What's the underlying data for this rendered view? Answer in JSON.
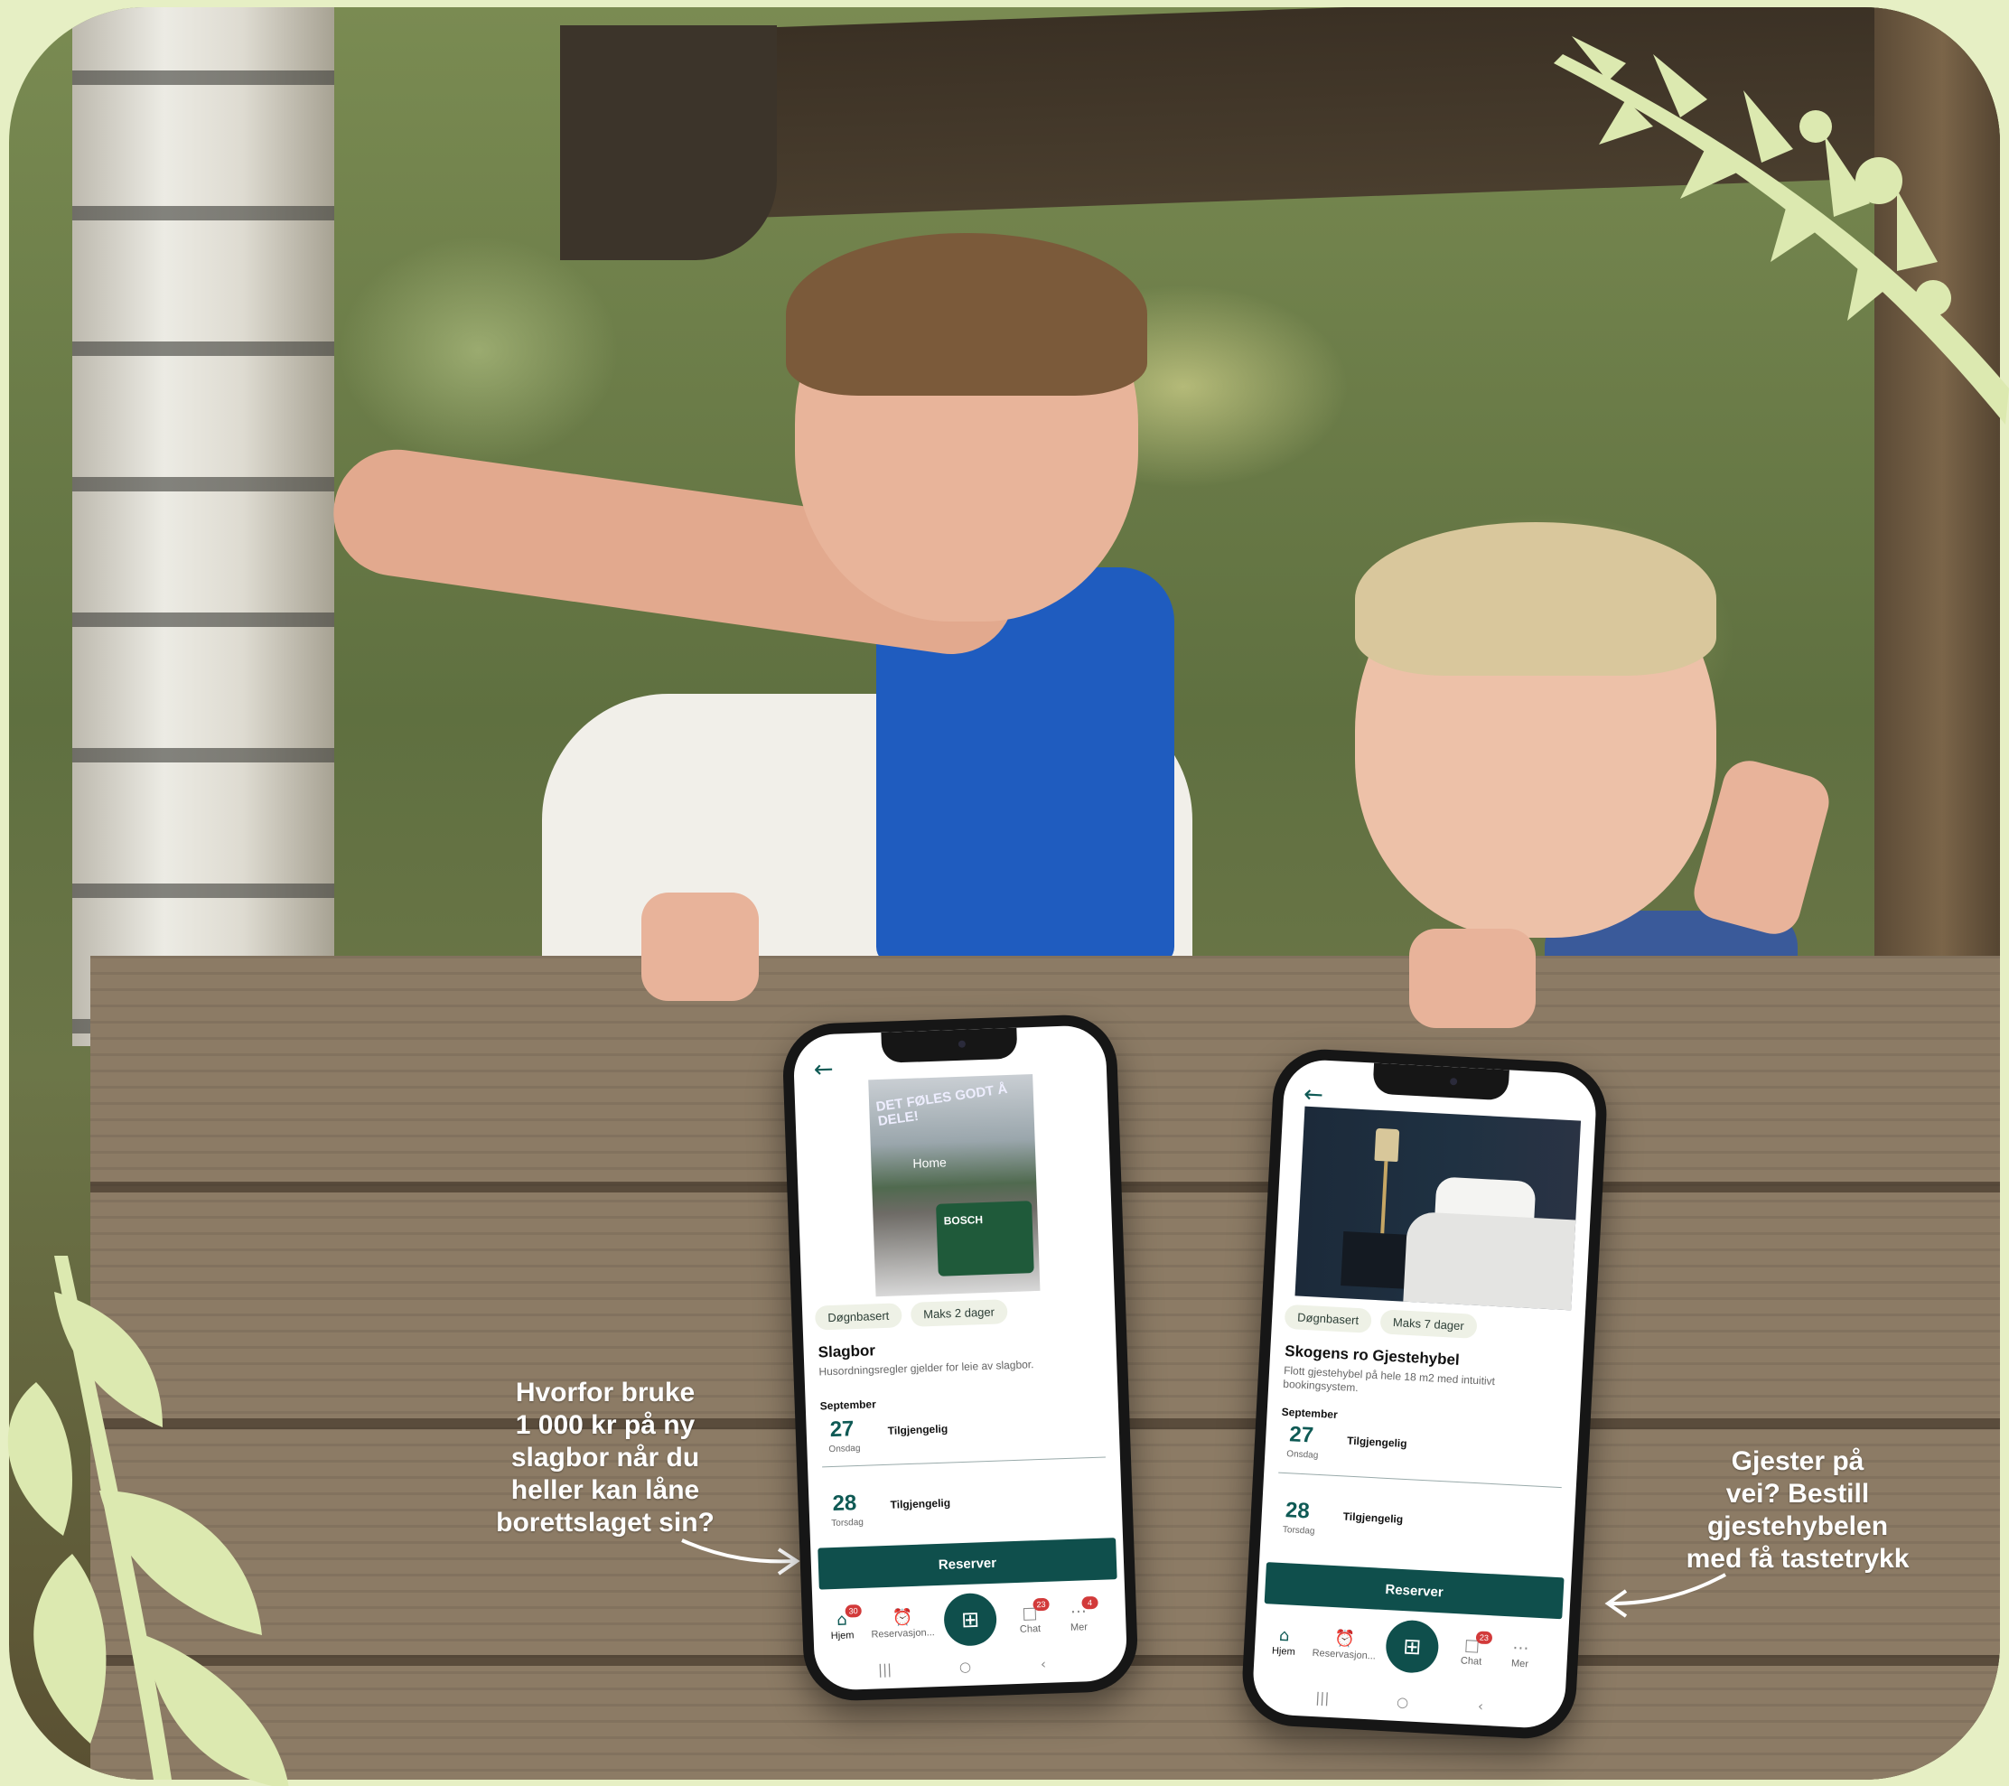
{
  "callouts": {
    "left": [
      "Hvorfor bruke",
      "1 000 kr på ny",
      "slagbor når du",
      "heller kan låne",
      "borettslaget sin?"
    ],
    "right": [
      "Gjester på",
      "vei? Bestill",
      "gjestehybelen",
      "med få tastetrykk"
    ]
  },
  "phone1": {
    "hero_slogan": "DET FØLES GODT Å DELE!",
    "hero_home": "Home",
    "hero_brand": "BOSCH",
    "tags": [
      "Døgnbasert",
      "Maks 2 dager"
    ],
    "title": "Slagbor",
    "description": "Husordningsregler gjelder for leie av slagbor.",
    "month": "September",
    "days": [
      {
        "num": "27",
        "name": "Onsdag",
        "status": "Tilgjengelig"
      },
      {
        "num": "28",
        "name": "Torsdag",
        "status": "Tilgjengelig"
      }
    ],
    "reserve_label": "Reserver",
    "tabs": [
      {
        "label": "Hjem",
        "icon": "home-icon",
        "badge": "30"
      },
      {
        "label": "Reservasjon...",
        "icon": "alarm-clock-icon",
        "badge": ""
      },
      {
        "label": "Chat",
        "icon": "chat-icon",
        "badge": "23"
      },
      {
        "label": "Mer",
        "icon": "more-icon",
        "badge": "4"
      }
    ]
  },
  "phone2": {
    "tags": [
      "Døgnbasert",
      "Maks 7 dager"
    ],
    "title": "Skogens ro Gjestehybel",
    "description": "Flott gjestehybel på hele 18 m2 med intuitivt bookingsystem.",
    "month": "September",
    "days": [
      {
        "num": "27",
        "name": "Onsdag",
        "status": "Tilgjengelig"
      },
      {
        "num": "28",
        "name": "Torsdag",
        "status": "Tilgjengelig"
      }
    ],
    "reserve_label": "Reserver",
    "tabs": [
      {
        "label": "Hjem",
        "icon": "home-icon",
        "badge": ""
      },
      {
        "label": "Reservasjon...",
        "icon": "alarm-clock-icon",
        "badge": ""
      },
      {
        "label": "Chat",
        "icon": "chat-icon",
        "badge": "23"
      },
      {
        "label": "Mer",
        "icon": "more-icon",
        "badge": ""
      }
    ]
  },
  "colors": {
    "accent": "#0f4f4c",
    "leaf": "#dce9b0",
    "page_bg": "#e6efc4",
    "badge": "#d23a3a"
  }
}
